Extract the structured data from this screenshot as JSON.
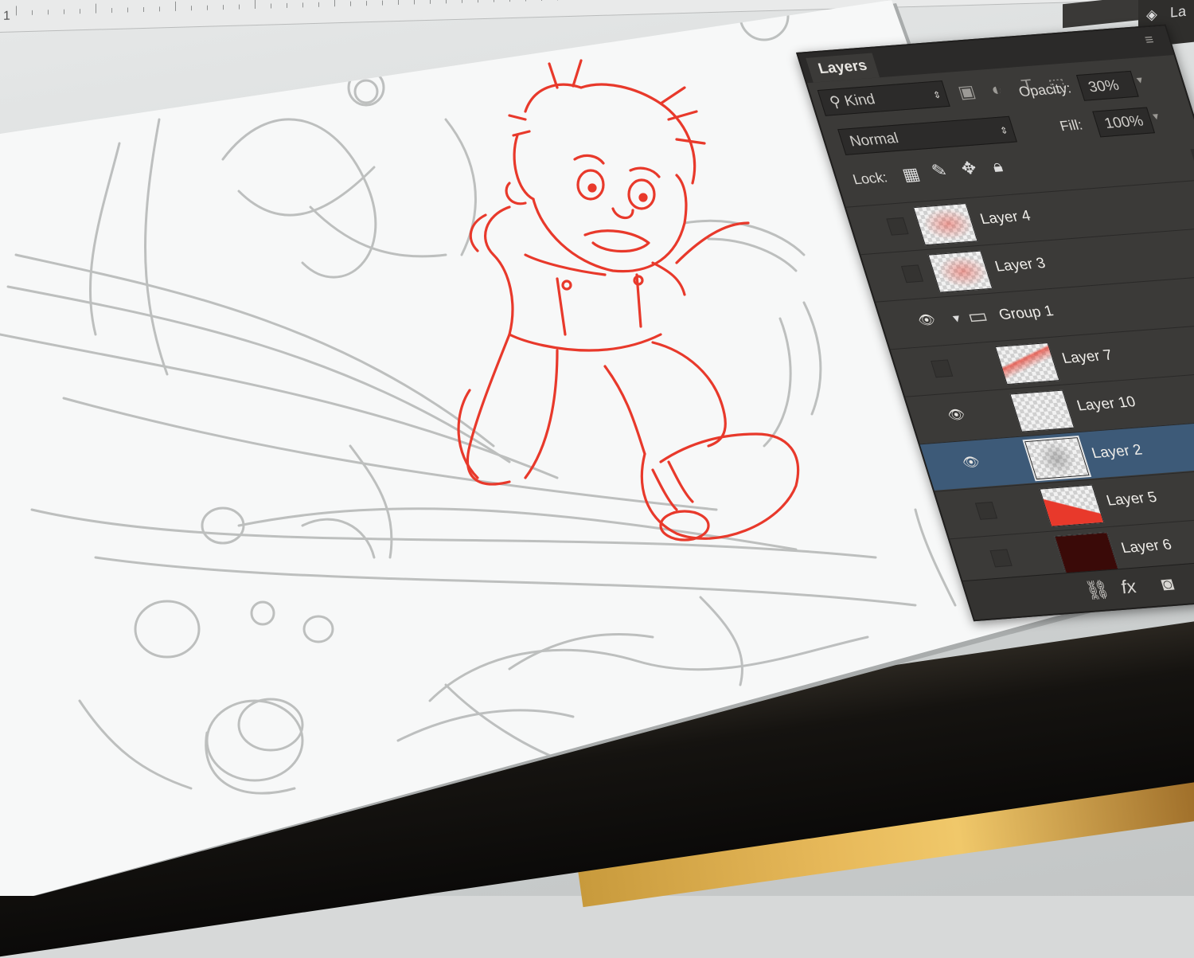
{
  "ruler": {
    "number": "1"
  },
  "panel": {
    "tab": "Layers",
    "filter_kind": "Kind",
    "blend_mode": "Normal",
    "opacity_label": "Opacity:",
    "opacity_value": "30%",
    "fill_label": "Fill:",
    "fill_value": "100%",
    "lock_label": "Lock:",
    "layers": [
      {
        "name": "Layer 4",
        "visible": false,
        "indent": 0,
        "selected": false,
        "thumb": "red-sketch"
      },
      {
        "name": "Layer 3",
        "visible": false,
        "indent": 0,
        "selected": false,
        "thumb": "red-sketch"
      },
      {
        "name": "Group 1",
        "visible": true,
        "indent": 0,
        "selected": false,
        "thumb": "folder"
      },
      {
        "name": "Layer 7",
        "visible": false,
        "indent": 1,
        "selected": false,
        "thumb": "red-stroke"
      },
      {
        "name": "Layer 10",
        "visible": true,
        "indent": 1,
        "selected": false,
        "thumb": "transparent"
      },
      {
        "name": "Layer 2",
        "visible": true,
        "indent": 1,
        "selected": true,
        "thumb": "gray-sketch"
      },
      {
        "name": "Layer 5",
        "visible": false,
        "indent": 1,
        "selected": false,
        "thumb": "red-fill"
      },
      {
        "name": "Layer 6",
        "visible": false,
        "indent": 1,
        "selected": false,
        "thumb": "dark-red"
      }
    ],
    "bottom_icons": [
      "link-icon",
      "fx-icon",
      "mask-icon",
      "adjustment-icon",
      "folder-icon"
    ],
    "fx_label": "fx"
  },
  "next_panel": {
    "label": "La"
  },
  "colors": {
    "panel_bg": "#3b3a38",
    "selected_row": "#3d5a78",
    "sketch_red": "#e8392b",
    "sketch_gray": "#a7aaa9"
  }
}
